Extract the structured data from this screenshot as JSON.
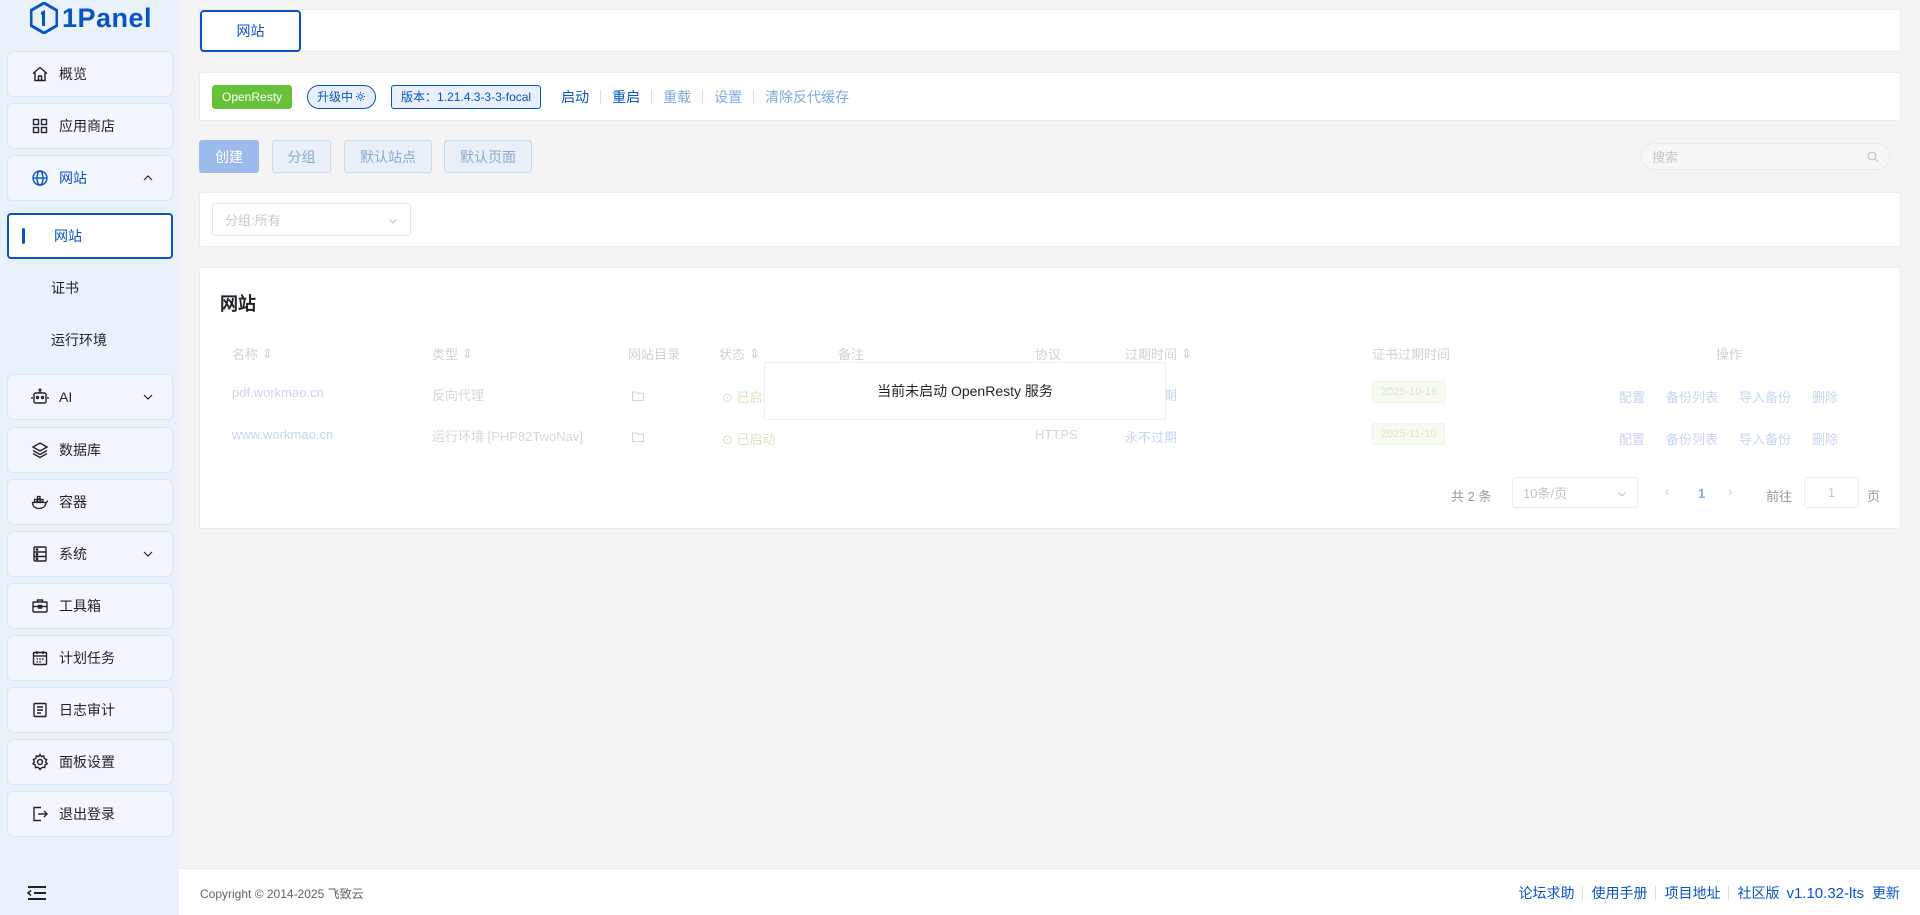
{
  "brand": {
    "name": "1Panel",
    "color": "#0854c7"
  },
  "sidebar": {
    "items": [
      {
        "key": "overview",
        "label": "概览",
        "icon": "home-icon"
      },
      {
        "key": "appstore",
        "label": "应用商店",
        "icon": "grid-icon"
      },
      {
        "key": "website",
        "label": "网站",
        "icon": "globe-icon",
        "expanded": true
      },
      {
        "key": "ai",
        "label": "AI",
        "icon": "robot-icon"
      },
      {
        "key": "database",
        "label": "数据库",
        "icon": "layers-icon"
      },
      {
        "key": "container",
        "label": "容器",
        "icon": "docker-icon"
      },
      {
        "key": "system",
        "label": "系统",
        "icon": "server-icon"
      },
      {
        "key": "toolbox",
        "label": "工具箱",
        "icon": "toolbox-icon"
      },
      {
        "key": "cron",
        "label": "计划任务",
        "icon": "calendar-icon"
      },
      {
        "key": "logs",
        "label": "日志审计",
        "icon": "log-icon"
      },
      {
        "key": "settings",
        "label": "面板设置",
        "icon": "gear-icon"
      },
      {
        "key": "logout",
        "label": "退出登录",
        "icon": "logout-icon"
      }
    ],
    "website_sub": [
      {
        "label": "网站",
        "active": true
      },
      {
        "label": "证书"
      },
      {
        "label": "运行环境"
      }
    ]
  },
  "tabs": {
    "active": "网站"
  },
  "status_bar": {
    "app_tag": "OpenResty",
    "state_tag": "升级中",
    "version_tag": "版本：1.21.4.3-3-3-focal",
    "actions": [
      "启动",
      "重启",
      "重载",
      "设置",
      "清除反代缓存"
    ]
  },
  "toolbar": {
    "buttons": [
      "创建",
      "分组",
      "默认站点",
      "默认页面"
    ],
    "search_placeholder": "搜索"
  },
  "filter": {
    "group_select": "分组:所有"
  },
  "table": {
    "title": "网站",
    "columns": [
      "名称",
      "类型",
      "网站目录",
      "状态",
      "备注",
      "协议",
      "过期时间",
      "证书过期时间",
      "操作"
    ],
    "rows": [
      {
        "name": "pdf.workmao.cn",
        "type": "反向代理",
        "status": "已启动",
        "protocol": "",
        "expire": "永不过期",
        "cert_expire": "2025-10-16",
        "ops": [
          "配置",
          "备份列表",
          "导入备份",
          "删除"
        ]
      },
      {
        "name": "www.workmao.cn",
        "type": "运行环境 [PHP82TwoNav]",
        "status": "已启动",
        "protocol": "HTTPS",
        "expire": "永不过期",
        "cert_expire": "2025-11-10",
        "ops": [
          "配置",
          "备份列表",
          "导入备份",
          "删除"
        ]
      }
    ],
    "pagination": {
      "total": "共 2 条",
      "page_size": "10条/页",
      "current": "1",
      "goto_label": "前往",
      "goto_value": "1",
      "page_suffix": "页"
    }
  },
  "overlay": {
    "message": "当前未启动 OpenResty 服务"
  },
  "footer": {
    "copyright": "Copyright © 2014-2025 飞致云",
    "links": [
      "论坛求助",
      "使用手册",
      "项目地址",
      "社区版"
    ],
    "version": "v1.10.32-lts",
    "update": "更新"
  }
}
